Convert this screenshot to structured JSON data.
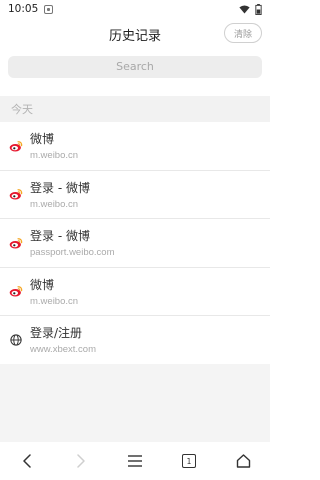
{
  "status_bar": {
    "time": "10:05",
    "icons": [
      "shield-icon",
      "wifi-icon",
      "battery-icon"
    ]
  },
  "header": {
    "title": "历史记录",
    "clear_label": "清除"
  },
  "search": {
    "placeholder": "Search"
  },
  "section": {
    "label": "今天"
  },
  "history": [
    {
      "title": "微博",
      "url": "m.weibo.cn",
      "icon": "weibo-icon"
    },
    {
      "title": "登录 - 微博",
      "url": "m.weibo.cn",
      "icon": "weibo-icon"
    },
    {
      "title": "登录 - 微博",
      "url": "passport.weibo.com",
      "icon": "weibo-icon"
    },
    {
      "title": "微博",
      "url": "m.weibo.cn",
      "icon": "weibo-icon"
    },
    {
      "title": "登录/注册",
      "url": "www.xbext.com",
      "icon": "globe-icon"
    }
  ],
  "bottom_nav": {
    "tab_count": "1",
    "items": [
      "back-icon",
      "forward-icon",
      "menu-icon",
      "tabs-icon",
      "home-icon"
    ]
  },
  "colors": {
    "weibo_red": "#e6162d",
    "weibo_orange": "#f5a623",
    "section_bg": "#f2f2f2"
  }
}
